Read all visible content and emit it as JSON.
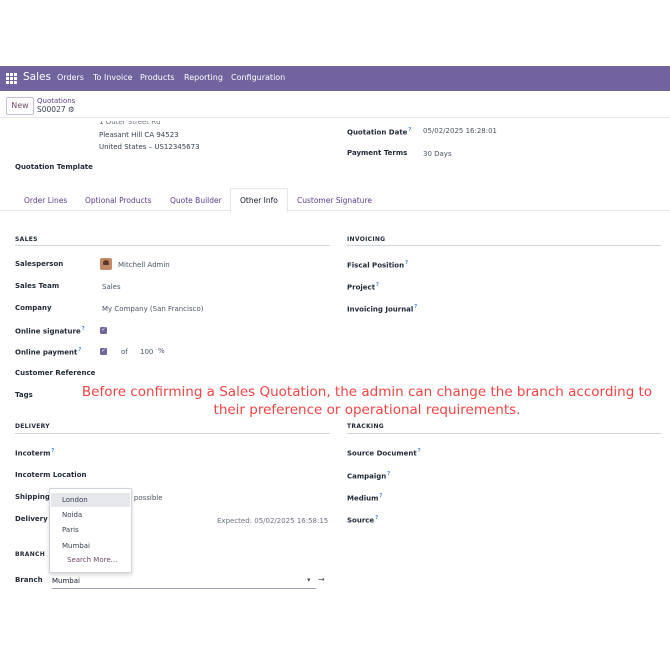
{
  "navbar": {
    "app_name": "Sales",
    "menu": [
      "Orders",
      "To Invoice",
      "Products",
      "Reporting",
      "Configuration"
    ]
  },
  "control_panel": {
    "new_label": "New",
    "breadcrumb": "Quotations",
    "record_name": "S00027"
  },
  "address": {
    "line_cut": "1 Outer Street Rd",
    "line1": "Pleasant Hill CA 94523",
    "line2": "United States – US12345673"
  },
  "header_fields": {
    "quotation_date_label": "Quotation Date",
    "quotation_date_value": "05/02/2025 16:28:01",
    "payment_terms_label": "Payment Terms",
    "payment_terms_value": "30 Days",
    "quotation_template_label": "Quotation Template"
  },
  "tabs": [
    {
      "label": "Order Lines"
    },
    {
      "label": "Optional Products"
    },
    {
      "label": "Quote Builder"
    },
    {
      "label": "Other Info"
    },
    {
      "label": "Customer Signature"
    }
  ],
  "sales": {
    "title": "SALES",
    "salesperson_label": "Salesperson",
    "salesperson_value": "Mitchell Admin",
    "sales_team_label": "Sales Team",
    "sales_team_value": "Sales",
    "company_label": "Company",
    "company_value": "My Company (San Francisco)",
    "online_signature_label": "Online signature",
    "online_payment_label": "Online payment",
    "online_payment_of": "of",
    "online_payment_amount": "100",
    "online_payment_pct": "%",
    "customer_reference_label": "Customer Reference",
    "tags_label": "Tags"
  },
  "invoicing": {
    "title": "INVOICING",
    "fiscal_position_label": "Fiscal Position",
    "project_label": "Project",
    "invoicing_journal_label": "Invoicing Journal"
  },
  "delivery": {
    "title": "DELIVERY",
    "incoterm_label": "Incoterm",
    "incoterm_location_label": "Incoterm Location",
    "shipping_label": "Shipping",
    "shipping_value_fragment": "s possible",
    "delivery_label_fragment": "Delivery I",
    "expected_text": "Expected: 05/02/2025 16:58:15"
  },
  "tracking": {
    "title": "TRACKING",
    "source_document_label": "Source Document",
    "campaign_label": "Campaign",
    "medium_label": "Medium",
    "source_label": "Source"
  },
  "branch": {
    "title": "BRANCH",
    "label": "Branch",
    "value": "Mumbai",
    "caret": "▾",
    "arrow": "→"
  },
  "dropdown": {
    "options": [
      "London",
      "Noida",
      "Paris",
      "Mumbai"
    ],
    "search_more": "Search More..."
  },
  "annotation": {
    "text": "Before confirming a Sales Quotation, the admin can change the branch according to their preference or operational requirements."
  },
  "colors": {
    "navbar": "#71639e",
    "accent": "#714b67",
    "annotation": "#ef4444",
    "help_mark": "#3b82f6"
  },
  "icons": {
    "apps": "apps-grid-icon",
    "gear": "gear-icon",
    "check": "checkbox-checked-icon",
    "help": "help-tooltip-icon"
  }
}
